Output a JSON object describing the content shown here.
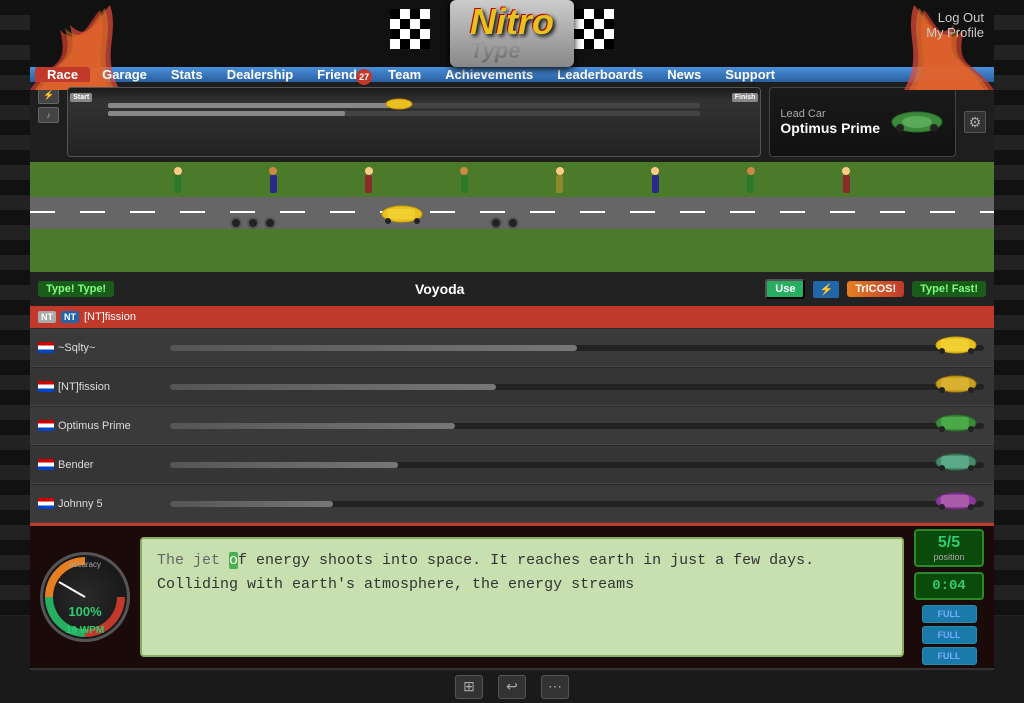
{
  "header": {
    "logo_nitro": "Nitro",
    "logo_type": "Type",
    "logout_label": "Log Out",
    "profile_label": "My Profile"
  },
  "nav": {
    "items": [
      {
        "label": "Race",
        "active": true,
        "badge": null
      },
      {
        "label": "Garage",
        "active": false,
        "badge": null
      },
      {
        "label": "Stats",
        "active": false,
        "badge": null
      },
      {
        "label": "Dealership",
        "active": false,
        "badge": null
      },
      {
        "label": "Friends",
        "active": false,
        "badge": "27"
      },
      {
        "label": "Team",
        "active": false,
        "badge": null
      },
      {
        "label": "Achievements",
        "active": false,
        "badge": null
      },
      {
        "label": "Leaderboards",
        "active": false,
        "badge": null
      },
      {
        "label": "News",
        "active": false,
        "badge": null
      },
      {
        "label": "Support",
        "active": false,
        "badge": null
      }
    ]
  },
  "race": {
    "lead_car_label": "Lead Car",
    "lead_car_name": "Optimus Prime",
    "start_label": "Start",
    "finish_label": "Finish",
    "track_label_1": "Type! Type!",
    "typing_word": "Voyoda",
    "use_label": "Use",
    "nitro_label": "TrICOS!",
    "type_fast_label": "Type! Fast!",
    "players": [
      {
        "name": "~Sqlty~",
        "progress": 50,
        "flag": "us"
      },
      {
        "name": "[NT]fission",
        "progress": 40,
        "flag": "nt"
      },
      {
        "name": "Optimus Prime",
        "progress": 35,
        "flag": "us"
      },
      {
        "name": "Bender",
        "progress": 28,
        "flag": "us"
      },
      {
        "name": "Johnny 5",
        "progress": 20,
        "flag": "us"
      }
    ]
  },
  "dashboard": {
    "accuracy_label": "accuracy",
    "accuracy_value": "100%",
    "wpm_value": "19 WPM",
    "position_label": "position",
    "position_value": "5/5",
    "time_value": "0:04",
    "nitro_bars": [
      "FULL",
      "FULL",
      "FULL"
    ],
    "text": "The jet of energy shoots into space. It reaches earth in just a few days. Colliding with earth's atmosphere, the energy streams",
    "typed_portion": "The jet ",
    "current_char": "o",
    "remaining_portion": "f energy shoots into space. It reaches earth in just a few days. Colliding with earth's atmosphere, the energy streams"
  }
}
